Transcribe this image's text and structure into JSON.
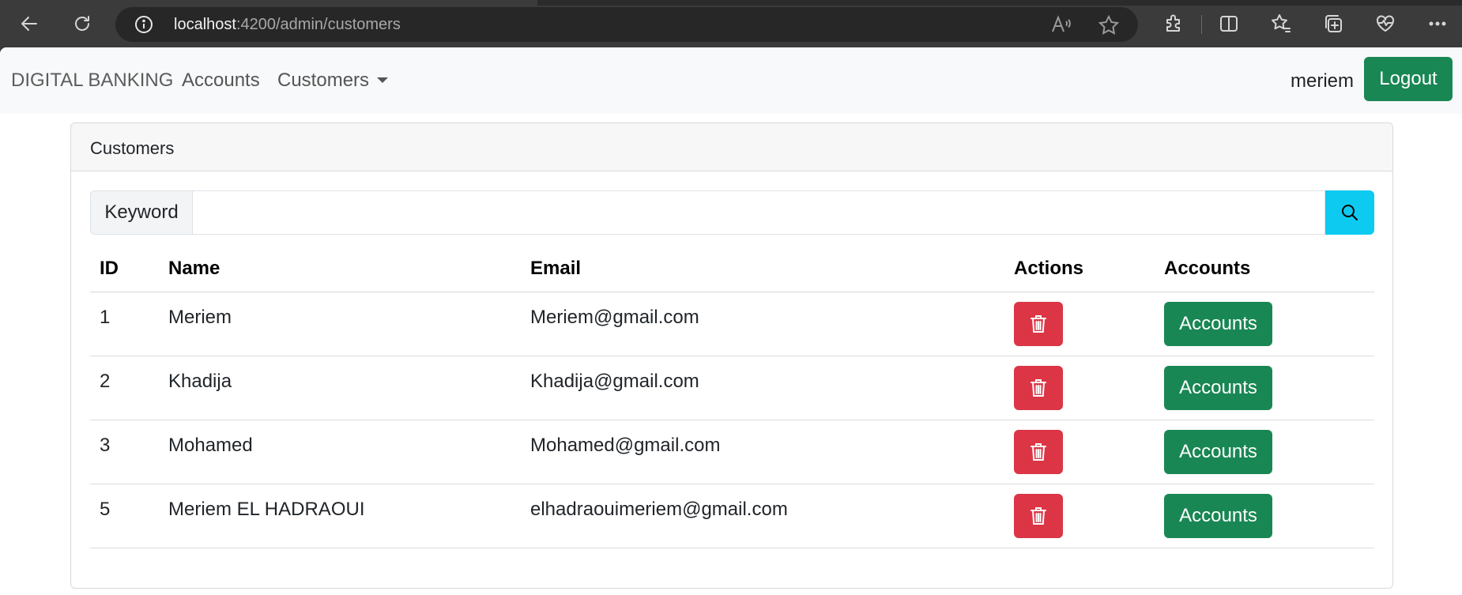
{
  "browser": {
    "url_host": "localhost",
    "url_path": ":4200/admin/customers"
  },
  "navbar": {
    "brand": "DIGITAL BANKING",
    "links": [
      {
        "label": "Accounts"
      },
      {
        "label": "Customers"
      }
    ],
    "username": "meriem",
    "logout_label": "Logout"
  },
  "card": {
    "title": "Customers",
    "search": {
      "label": "Keyword",
      "value": "",
      "placeholder": ""
    }
  },
  "table": {
    "headers": [
      "ID",
      "Name",
      "Email",
      "Actions",
      "Accounts"
    ],
    "rows": [
      {
        "id": "1",
        "name": "Meriem",
        "email": "Meriem@gmail.com",
        "accounts_label": "Accounts"
      },
      {
        "id": "2",
        "name": "Khadija",
        "email": "Khadija@gmail.com",
        "accounts_label": "Accounts"
      },
      {
        "id": "3",
        "name": "Mohamed",
        "email": "Mohamed@gmail.com",
        "accounts_label": "Accounts"
      },
      {
        "id": "5",
        "name": "Meriem EL HADRAOUI",
        "email": "elhadraouimeriem@gmail.com",
        "accounts_label": "Accounts"
      }
    ]
  },
  "colors": {
    "success": "#198754",
    "danger": "#dc3545",
    "info": "#0dcaf0"
  }
}
